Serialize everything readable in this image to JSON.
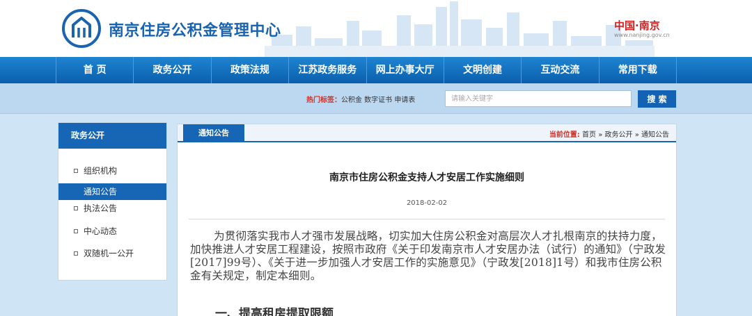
{
  "header": {
    "site_title": "南京住房公积金管理中心",
    "region_title": "中国·南京",
    "region_url": "www.nanjing.gov.cn",
    "logo_icon": "house-circle-logo-icon"
  },
  "nav": {
    "items": [
      "首 页",
      "政务公开",
      "政策法规",
      "江苏政务服务",
      "网上办事大厅",
      "文明创建",
      "互动交流",
      "常用下载"
    ]
  },
  "search": {
    "hot_label": "热门标签：",
    "hot_tags": "公积金 数字证书 申请表",
    "placeholder": "请输入关键字",
    "button": "搜 索"
  },
  "sidebar": {
    "title": "政务公开",
    "items": [
      "组织机构",
      "通知公告",
      "执法公告",
      "中心动态",
      "双随机一公开"
    ],
    "active_index": 1
  },
  "content": {
    "tab": "通知公告",
    "breadcrumb_label": "当前位置:",
    "breadcrumb": [
      "首页",
      "政务公开",
      "通知公告"
    ],
    "breadcrumb_sep": "»",
    "title": "南京市住房公积金支持人才安居工作实施细则",
    "date": "2018-02-02",
    "paragraph": "为贯彻落实我市人才强市发展战略，切实加大住房公积金对高层次人才扎根南京的扶持力度，加快推进人才安居工程建设，按照市政府《关于印发南京市人才安居办法（试行）的通知》（宁政发[2017]99号）、《关于进一步加强人才安居工作的实施意见》（宁政发[2018]1号）和我市住房公积金有关规定，制定本细则。",
    "section_heading": "一、提高租房提取限额"
  },
  "colors": {
    "brand_blue": "#1766b6",
    "nav_blue": "#0a5fad",
    "accent_red": "#c8332b"
  }
}
